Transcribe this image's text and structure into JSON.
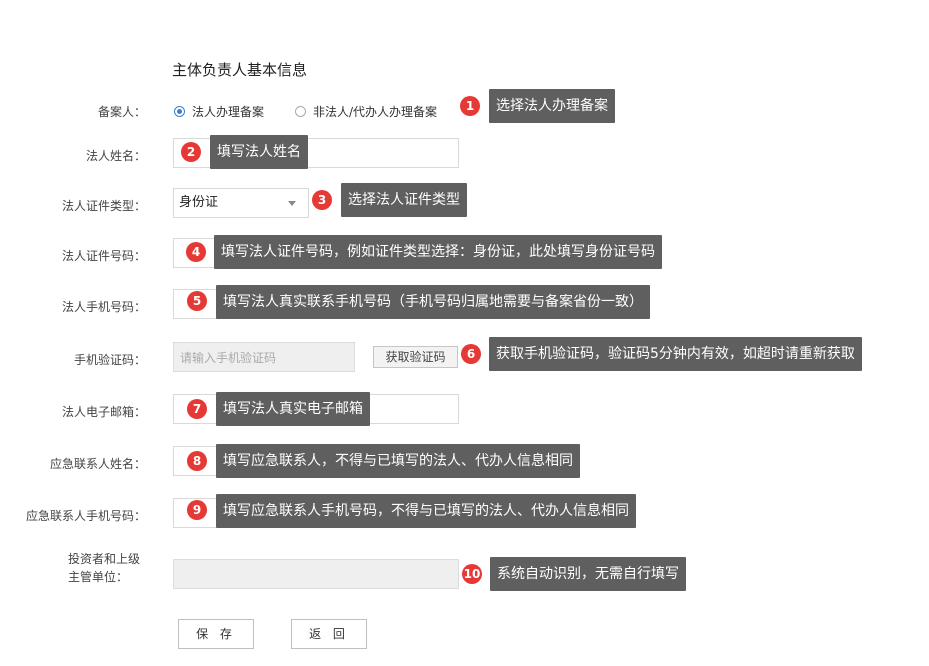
{
  "page": {
    "title": "主体负责人基本信息"
  },
  "form": {
    "filer": {
      "label": "备案人：",
      "options": [
        "法人办理备案",
        "非法人/代办人办理备案"
      ],
      "selected": "法人办理备案"
    },
    "legal_name": {
      "label": "法人姓名：",
      "value": ""
    },
    "id_type": {
      "label": "法人证件类型：",
      "value": "身份证"
    },
    "id_number": {
      "label": "法人证件号码：",
      "value": ""
    },
    "phone": {
      "label": "法人手机号码：",
      "value": ""
    },
    "sms_code": {
      "label": "手机验证码：",
      "placeholder": "请输入手机验证码",
      "button": "获取验证码"
    },
    "email": {
      "label": "法人电子邮箱：",
      "value": ""
    },
    "emergency_name": {
      "label": "应急联系人姓名：",
      "value": ""
    },
    "emergency_phone": {
      "label": "应急联系人手机号码：",
      "value": ""
    },
    "investor": {
      "label_line1": "投资者和上级",
      "label_line2": "主管单位：",
      "value": ""
    }
  },
  "buttons": {
    "save": "保 存",
    "back": "返 回"
  },
  "annotations": [
    {
      "num": "1",
      "text": "选择法人办理备案"
    },
    {
      "num": "2",
      "text": "填写法人姓名"
    },
    {
      "num": "3",
      "text": "选择法人证件类型"
    },
    {
      "num": "4",
      "text": "填写法人证件号码，例如证件类型选择：身份证，此处填写身份证号码"
    },
    {
      "num": "5",
      "text": "填写法人真实联系手机号码（手机号码归属地需要与备案省份一致）"
    },
    {
      "num": "6",
      "text": "获取手机验证码，验证码5分钟内有效，如超时请重新获取"
    },
    {
      "num": "7",
      "text": "填写法人真实电子邮箱"
    },
    {
      "num": "8",
      "text": "填写应急联系人，不得与已填写的法人、代办人信息相同"
    },
    {
      "num": "9",
      "text": "填写应急联系人手机号码，不得与已填写的法人、代办人信息相同"
    },
    {
      "num": "10",
      "text": "系统自动识别，无需自行填写"
    }
  ],
  "colors": {
    "badge": "#e53935",
    "tooltip_bg": "#5f5f5f",
    "radio_accent": "#3b7dd8"
  }
}
